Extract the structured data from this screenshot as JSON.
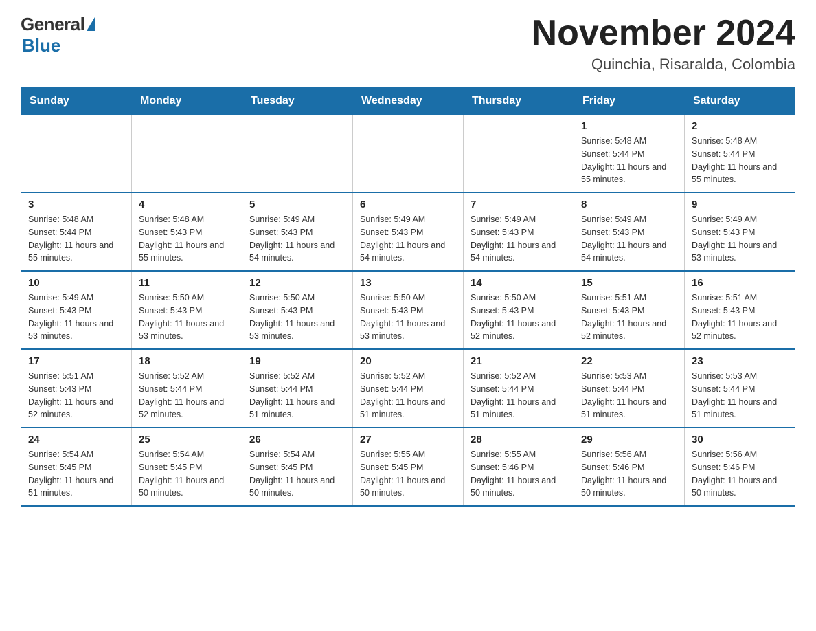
{
  "logo": {
    "general": "General",
    "blue": "Blue"
  },
  "header": {
    "month_year": "November 2024",
    "location": "Quinchia, Risaralda, Colombia"
  },
  "days_of_week": [
    "Sunday",
    "Monday",
    "Tuesday",
    "Wednesday",
    "Thursday",
    "Friday",
    "Saturday"
  ],
  "weeks": [
    [
      {
        "day": "",
        "sunrise": "",
        "sunset": "",
        "daylight": "",
        "empty": true
      },
      {
        "day": "",
        "sunrise": "",
        "sunset": "",
        "daylight": "",
        "empty": true
      },
      {
        "day": "",
        "sunrise": "",
        "sunset": "",
        "daylight": "",
        "empty": true
      },
      {
        "day": "",
        "sunrise": "",
        "sunset": "",
        "daylight": "",
        "empty": true
      },
      {
        "day": "",
        "sunrise": "",
        "sunset": "",
        "daylight": "",
        "empty": true
      },
      {
        "day": "1",
        "sunrise": "Sunrise: 5:48 AM",
        "sunset": "Sunset: 5:44 PM",
        "daylight": "Daylight: 11 hours and 55 minutes.",
        "empty": false
      },
      {
        "day": "2",
        "sunrise": "Sunrise: 5:48 AM",
        "sunset": "Sunset: 5:44 PM",
        "daylight": "Daylight: 11 hours and 55 minutes.",
        "empty": false
      }
    ],
    [
      {
        "day": "3",
        "sunrise": "Sunrise: 5:48 AM",
        "sunset": "Sunset: 5:44 PM",
        "daylight": "Daylight: 11 hours and 55 minutes.",
        "empty": false
      },
      {
        "day": "4",
        "sunrise": "Sunrise: 5:48 AM",
        "sunset": "Sunset: 5:43 PM",
        "daylight": "Daylight: 11 hours and 55 minutes.",
        "empty": false
      },
      {
        "day": "5",
        "sunrise": "Sunrise: 5:49 AM",
        "sunset": "Sunset: 5:43 PM",
        "daylight": "Daylight: 11 hours and 54 minutes.",
        "empty": false
      },
      {
        "day": "6",
        "sunrise": "Sunrise: 5:49 AM",
        "sunset": "Sunset: 5:43 PM",
        "daylight": "Daylight: 11 hours and 54 minutes.",
        "empty": false
      },
      {
        "day": "7",
        "sunrise": "Sunrise: 5:49 AM",
        "sunset": "Sunset: 5:43 PM",
        "daylight": "Daylight: 11 hours and 54 minutes.",
        "empty": false
      },
      {
        "day": "8",
        "sunrise": "Sunrise: 5:49 AM",
        "sunset": "Sunset: 5:43 PM",
        "daylight": "Daylight: 11 hours and 54 minutes.",
        "empty": false
      },
      {
        "day": "9",
        "sunrise": "Sunrise: 5:49 AM",
        "sunset": "Sunset: 5:43 PM",
        "daylight": "Daylight: 11 hours and 53 minutes.",
        "empty": false
      }
    ],
    [
      {
        "day": "10",
        "sunrise": "Sunrise: 5:49 AM",
        "sunset": "Sunset: 5:43 PM",
        "daylight": "Daylight: 11 hours and 53 minutes.",
        "empty": false
      },
      {
        "day": "11",
        "sunrise": "Sunrise: 5:50 AM",
        "sunset": "Sunset: 5:43 PM",
        "daylight": "Daylight: 11 hours and 53 minutes.",
        "empty": false
      },
      {
        "day": "12",
        "sunrise": "Sunrise: 5:50 AM",
        "sunset": "Sunset: 5:43 PM",
        "daylight": "Daylight: 11 hours and 53 minutes.",
        "empty": false
      },
      {
        "day": "13",
        "sunrise": "Sunrise: 5:50 AM",
        "sunset": "Sunset: 5:43 PM",
        "daylight": "Daylight: 11 hours and 53 minutes.",
        "empty": false
      },
      {
        "day": "14",
        "sunrise": "Sunrise: 5:50 AM",
        "sunset": "Sunset: 5:43 PM",
        "daylight": "Daylight: 11 hours and 52 minutes.",
        "empty": false
      },
      {
        "day": "15",
        "sunrise": "Sunrise: 5:51 AM",
        "sunset": "Sunset: 5:43 PM",
        "daylight": "Daylight: 11 hours and 52 minutes.",
        "empty": false
      },
      {
        "day": "16",
        "sunrise": "Sunrise: 5:51 AM",
        "sunset": "Sunset: 5:43 PM",
        "daylight": "Daylight: 11 hours and 52 minutes.",
        "empty": false
      }
    ],
    [
      {
        "day": "17",
        "sunrise": "Sunrise: 5:51 AM",
        "sunset": "Sunset: 5:43 PM",
        "daylight": "Daylight: 11 hours and 52 minutes.",
        "empty": false
      },
      {
        "day": "18",
        "sunrise": "Sunrise: 5:52 AM",
        "sunset": "Sunset: 5:44 PM",
        "daylight": "Daylight: 11 hours and 52 minutes.",
        "empty": false
      },
      {
        "day": "19",
        "sunrise": "Sunrise: 5:52 AM",
        "sunset": "Sunset: 5:44 PM",
        "daylight": "Daylight: 11 hours and 51 minutes.",
        "empty": false
      },
      {
        "day": "20",
        "sunrise": "Sunrise: 5:52 AM",
        "sunset": "Sunset: 5:44 PM",
        "daylight": "Daylight: 11 hours and 51 minutes.",
        "empty": false
      },
      {
        "day": "21",
        "sunrise": "Sunrise: 5:52 AM",
        "sunset": "Sunset: 5:44 PM",
        "daylight": "Daylight: 11 hours and 51 minutes.",
        "empty": false
      },
      {
        "day": "22",
        "sunrise": "Sunrise: 5:53 AM",
        "sunset": "Sunset: 5:44 PM",
        "daylight": "Daylight: 11 hours and 51 minutes.",
        "empty": false
      },
      {
        "day": "23",
        "sunrise": "Sunrise: 5:53 AM",
        "sunset": "Sunset: 5:44 PM",
        "daylight": "Daylight: 11 hours and 51 minutes.",
        "empty": false
      }
    ],
    [
      {
        "day": "24",
        "sunrise": "Sunrise: 5:54 AM",
        "sunset": "Sunset: 5:45 PM",
        "daylight": "Daylight: 11 hours and 51 minutes.",
        "empty": false
      },
      {
        "day": "25",
        "sunrise": "Sunrise: 5:54 AM",
        "sunset": "Sunset: 5:45 PM",
        "daylight": "Daylight: 11 hours and 50 minutes.",
        "empty": false
      },
      {
        "day": "26",
        "sunrise": "Sunrise: 5:54 AM",
        "sunset": "Sunset: 5:45 PM",
        "daylight": "Daylight: 11 hours and 50 minutes.",
        "empty": false
      },
      {
        "day": "27",
        "sunrise": "Sunrise: 5:55 AM",
        "sunset": "Sunset: 5:45 PM",
        "daylight": "Daylight: 11 hours and 50 minutes.",
        "empty": false
      },
      {
        "day": "28",
        "sunrise": "Sunrise: 5:55 AM",
        "sunset": "Sunset: 5:46 PM",
        "daylight": "Daylight: 11 hours and 50 minutes.",
        "empty": false
      },
      {
        "day": "29",
        "sunrise": "Sunrise: 5:56 AM",
        "sunset": "Sunset: 5:46 PM",
        "daylight": "Daylight: 11 hours and 50 minutes.",
        "empty": false
      },
      {
        "day": "30",
        "sunrise": "Sunrise: 5:56 AM",
        "sunset": "Sunset: 5:46 PM",
        "daylight": "Daylight: 11 hours and 50 minutes.",
        "empty": false
      }
    ]
  ]
}
